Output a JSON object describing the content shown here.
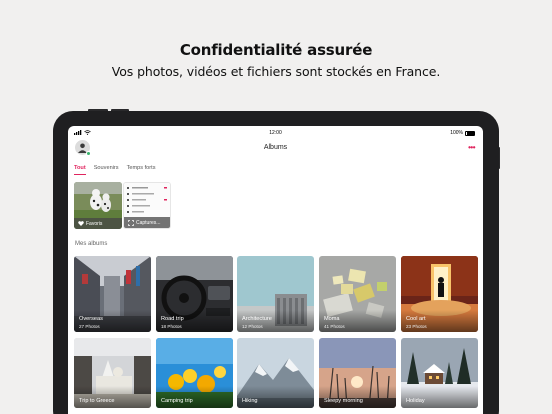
{
  "marketing": {
    "title": "Confidentialité assurée",
    "subtitle": "Vos photos, vidéos et fichiers sont stockés en France."
  },
  "status_bar": {
    "time": "12:00",
    "battery": "100%"
  },
  "nav": {
    "title": "Albums",
    "more_icon": "more-dots-icon"
  },
  "tabs": [
    {
      "label": "Tout",
      "active": true
    },
    {
      "label": "Souvenirs",
      "active": false
    },
    {
      "label": "Temps forts",
      "active": false
    }
  ],
  "quick_albums": [
    {
      "label": "Favoris",
      "icon": "heart-icon"
    },
    {
      "label": "Captures...",
      "icon": "screenshot-icon"
    }
  ],
  "albums_section": {
    "label": "Mes albums"
  },
  "albums": [
    {
      "name": "Overseas",
      "count": "27 Photos"
    },
    {
      "name": "Road trip",
      "count": "18 Photos"
    },
    {
      "name": "Architecture",
      "count": "12 Photos"
    },
    {
      "name": "Moma",
      "count": "41 Photos"
    },
    {
      "name": "Cool art",
      "count": "23 Photos"
    },
    {
      "name": "Trip to Greece",
      "count": ""
    },
    {
      "name": "Camping trip",
      "count": ""
    },
    {
      "name": "Hiking",
      "count": ""
    },
    {
      "name": "Sleepy morning",
      "count": ""
    },
    {
      "name": "Holiday",
      "count": ""
    }
  ],
  "colors": {
    "accent": "#e0245e",
    "online": "#3ab46e"
  }
}
